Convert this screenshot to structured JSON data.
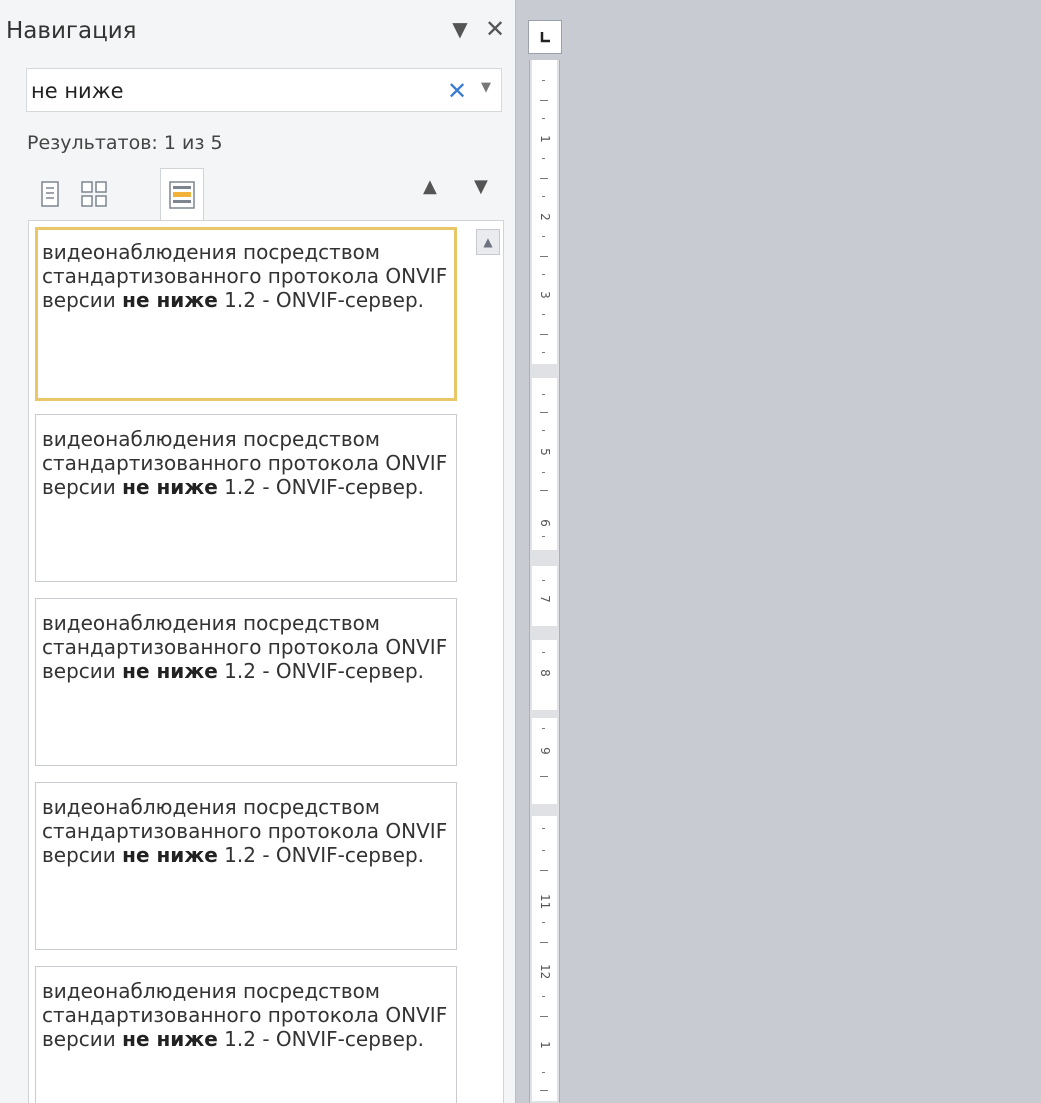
{
  "nav": {
    "title": "Навигация",
    "dropdown_icon": "chevron-down-icon",
    "close_icon": "close-icon"
  },
  "search": {
    "value": "не ниже",
    "clear_icon": "clear-icon"
  },
  "results_count": "Результатов: 1 из 5",
  "view_tabs": [
    "headings-view",
    "pages-view",
    "results-view"
  ],
  "active_tab": "results-view",
  "results": [
    {
      "before": "видеонаблюдения посредством стандартизованного протокола ONVIF версии ",
      "match": "не ниже",
      "after": " 1.2 - ONVIF-сервер."
    },
    {
      "before": "видеонаблюдения посредством стандартизованного протокола ONVIF версии ",
      "match": "не ниже",
      "after": " 1.2 - ONVIF-сервер."
    },
    {
      "before": "видеонаблюдения посредством стандартизованного протокола ONVIF версии ",
      "match": "не ниже",
      "after": " 1.2 - ONVIF-сервер."
    },
    {
      "before": "видеонаблюдения посредством стандартизованного протокола ONVIF версии ",
      "match": "не ниже",
      "after": " 1.2 - ONVIF-сервер."
    },
    {
      "before": "видеонаблюдения посредством стандартизованного протокола ONVIF версии ",
      "match": "не ниже",
      "after": " 1.2 - ONVIF-сервер."
    }
  ],
  "ruler": {
    "tab_stop_icon": "left-tab-icon",
    "numbers": [
      "1",
      "2",
      "3",
      "5",
      "6",
      "7",
      "8",
      "9",
      "11",
      "12",
      "1"
    ]
  },
  "colors": {
    "selected_border": "#e9c667",
    "clear_icon": "#3a7bd5",
    "pane_bg": "#f4f5f6",
    "workspace_bg": "#c8ccd2"
  }
}
